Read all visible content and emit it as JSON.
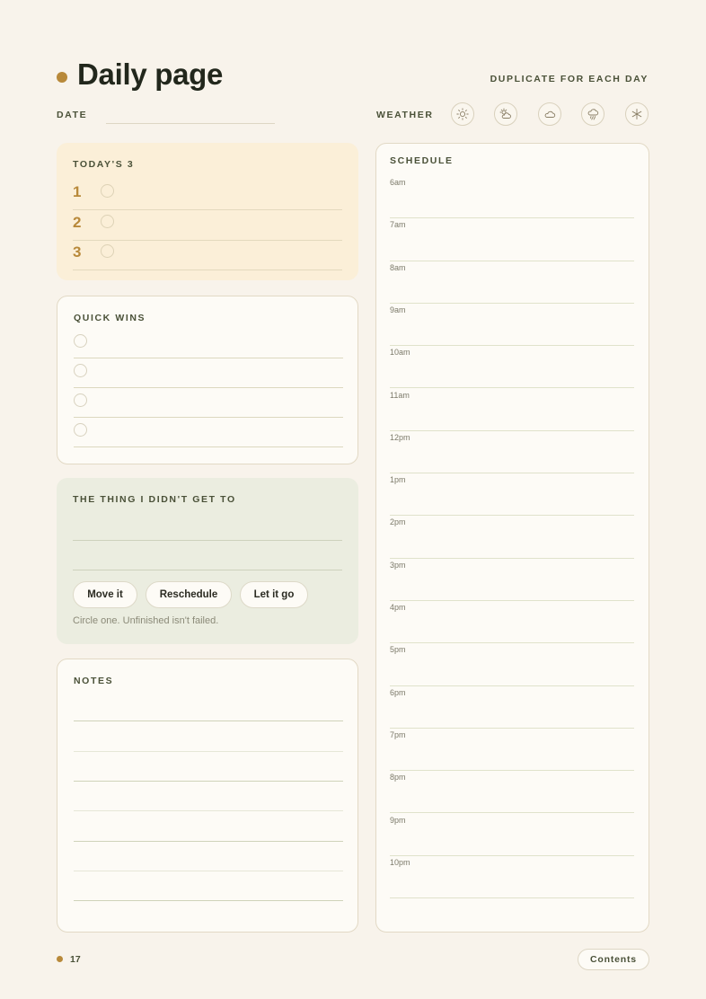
{
  "header": {
    "title": "Daily page",
    "duplicate_note": "DUPLICATE FOR EACH DAY",
    "date_label": "DATE",
    "weather_label": "WEATHER",
    "weather_icons": [
      "sun-icon",
      "partly-cloudy-icon",
      "cloud-icon",
      "rain-icon",
      "snow-icon"
    ]
  },
  "todays3": {
    "title": "TODAY'S 3",
    "items": [
      "1",
      "2",
      "3"
    ]
  },
  "quick_wins": {
    "title": "QUICK WINS",
    "count": 4
  },
  "thing": {
    "title": "THE THING I DIDN'T GET TO",
    "options": [
      "Move it",
      "Reschedule",
      "Let it go"
    ],
    "note": "Circle one. Unfinished isn't failed."
  },
  "notes": {
    "title": "NOTES"
  },
  "schedule": {
    "title": "SCHEDULE",
    "times": [
      "6am",
      "7am",
      "8am",
      "9am",
      "10am",
      "11am",
      "12pm",
      "1pm",
      "2pm",
      "3pm",
      "4pm",
      "5pm",
      "6pm",
      "7pm",
      "8pm",
      "9pm",
      "10pm"
    ]
  },
  "footer": {
    "page_number": "17",
    "contents_label": "Contents"
  },
  "colors": {
    "background": "#f8f3eb",
    "accent": "#b8893a",
    "today_bg": "#fbefd8",
    "thing_bg": "#ebede0",
    "text_dark": "#22271c"
  }
}
